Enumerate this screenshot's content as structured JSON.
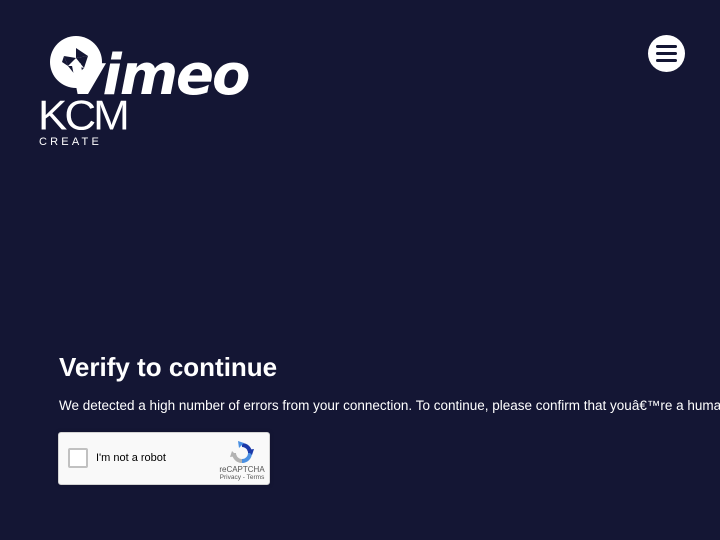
{
  "header": {
    "brand_wordmark": "vimeo",
    "kcm_letters": "KCM",
    "kcm_sub": "CREATE",
    "menu_icon": "hamburger-menu-icon"
  },
  "main": {
    "title": "Verify to continue",
    "message": "We detected a high number of errors from your connection. To continue, please confirm that youâ€™re a human (and not a spambot)."
  },
  "recaptcha": {
    "label": "I'm not a robot",
    "brand": "reCAPTCHA",
    "privacy": "Privacy",
    "separator": " - ",
    "terms": "Terms",
    "logo_icon": "recaptcha-logo-icon"
  },
  "colors": {
    "background": "#141634",
    "text": "#ffffff",
    "recaptcha_bg": "#f9f9f9",
    "recaptcha_blue": "#4a90e2",
    "recaptcha_gray": "#b3b3b3"
  }
}
